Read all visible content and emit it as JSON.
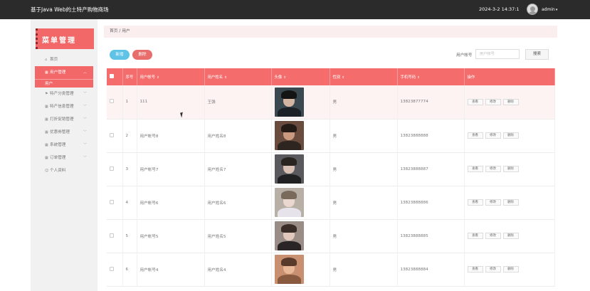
{
  "header": {
    "title": "基于Java Web的土特产购物商场",
    "time": "2024-3-2 14:37:1",
    "user": "admin"
  },
  "sidebar": {
    "logo": "菜单管理",
    "items": [
      {
        "label": "首页",
        "icon": "home-icon"
      },
      {
        "label": "用户管理",
        "icon": "grid-icon",
        "active": true
      },
      {
        "label": "特产分类管理",
        "icon": "flag-icon"
      },
      {
        "label": "特产信息管理",
        "icon": "grid-icon"
      },
      {
        "label": "打折促销管理",
        "icon": "grid-icon"
      },
      {
        "label": "优惠券管理",
        "icon": "grid-icon"
      },
      {
        "label": "系统管理",
        "icon": "grid-icon"
      },
      {
        "label": "订单管理",
        "icon": "grid-icon"
      },
      {
        "label": "个人资料",
        "icon": "person-icon"
      }
    ],
    "sub_item": "用户"
  },
  "breadcrumb": "首页 / 用户",
  "toolbar": {
    "add": "新增",
    "delete": "删除",
    "search_label": "用户帐号",
    "search_placeholder": "用户帐号",
    "search_button": "搜索"
  },
  "table": {
    "columns": [
      "序号",
      "用户帐号",
      "用户姓名",
      "头像",
      "性别",
      "手机号码",
      "操作"
    ],
    "rows": [
      {
        "index": "1",
        "account": "111",
        "name": "王强",
        "gender": "男",
        "phone": "13823877774"
      },
      {
        "index": "2",
        "account": "用户帐号8",
        "name": "用户姓名8",
        "gender": "男",
        "phone": "13823888888"
      },
      {
        "index": "3",
        "account": "用户帐号7",
        "name": "用户姓名7",
        "gender": "男",
        "phone": "13823888887"
      },
      {
        "index": "4",
        "account": "用户帐号6",
        "name": "用户姓名6",
        "gender": "男",
        "phone": "13823888886"
      },
      {
        "index": "5",
        "account": "用户帐号5",
        "name": "用户姓名5",
        "gender": "男",
        "phone": "13823888885"
      },
      {
        "index": "6",
        "account": "用户帐号4",
        "name": "用户姓名4",
        "gender": "男",
        "phone": "13823888884"
      }
    ],
    "actions": [
      "查看",
      "修改",
      "删除"
    ]
  },
  "colors": {
    "accent": "#f56c6c",
    "topbar": "#2b2b2b",
    "add_button": "#5fc3e6"
  }
}
